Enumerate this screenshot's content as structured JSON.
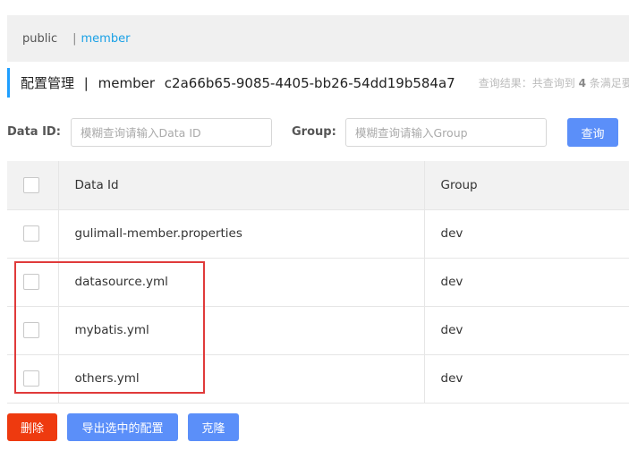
{
  "namespaces": {
    "public": "public",
    "separator": "|",
    "member": "member"
  },
  "title": {
    "prefix": "配置管理",
    "divider": "|",
    "namespace_name": "member",
    "namespace_id": "c2a66b65-9085-4405-bb26-54dd19b584a7",
    "result_prefix": "查询结果：共查询到",
    "result_count": "4",
    "result_suffix": "条满足要求的"
  },
  "search": {
    "data_id_label": "Data ID:",
    "data_id_placeholder": "模糊查询请输入Data ID",
    "group_label": "Group:",
    "group_placeholder": "模糊查询请输入Group",
    "query_button": "查询"
  },
  "table": {
    "headers": {
      "data_id": "Data Id",
      "group": "Group"
    },
    "rows": [
      {
        "data_id": "gulimall-member.properties",
        "group": "dev"
      },
      {
        "data_id": "datasource.yml",
        "group": "dev"
      },
      {
        "data_id": "mybatis.yml",
        "group": "dev"
      },
      {
        "data_id": "others.yml",
        "group": "dev"
      }
    ]
  },
  "actions": {
    "delete": "删除",
    "export": "导出选中的配置",
    "clone": "克隆"
  },
  "colors": {
    "accent": "#5b8ff9",
    "danger": "#ee3a0f",
    "highlight": "#e03a3a",
    "link": "#1aa1e6"
  }
}
